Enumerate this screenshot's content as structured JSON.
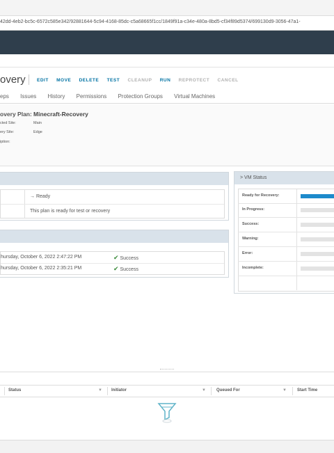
{
  "address_bar": {
    "url": "42dd-4eb2-bc5c-6572c585e342/92881644-5c94-4168-85dc-c5a68665f1cc/1849f91a-c34e-480a-8bd5-cf34f89d5374/699130d9-3056-47a1-"
  },
  "page": {
    "title": "overy",
    "actions": [
      {
        "label": "EDIT",
        "enabled": true
      },
      {
        "label": "MOVE",
        "enabled": true
      },
      {
        "label": "DELETE",
        "enabled": true
      },
      {
        "label": "TEST",
        "enabled": true
      },
      {
        "label": "CLEANUP",
        "enabled": false
      },
      {
        "label": "RUN",
        "enabled": true
      },
      {
        "label": "REPROTECT",
        "enabled": false
      },
      {
        "label": "CANCEL",
        "enabled": false
      }
    ],
    "tabs": [
      "eps",
      "Issues",
      "History",
      "Permissions",
      "Protection Groups",
      "Virtual Machines"
    ]
  },
  "summary": {
    "plan_label": "overy Plan:",
    "plan_name": "Minecraft-Recovery",
    "protected_label": "cted Site:",
    "protected_value": "Main",
    "recovery_label": "ery Site:",
    "recovery_value": "Edge",
    "description_label": "iption:"
  },
  "plan_status": {
    "status_text": "→ Ready",
    "message": "This plan is ready for test or recovery"
  },
  "history": {
    "rows": [
      {
        "date": "hursday, October 6, 2022 2:47:22 PM",
        "result": "Success"
      },
      {
        "date": "hursday, October 6, 2022 2:35:21 PM",
        "result": "Success"
      }
    ]
  },
  "vm_status": {
    "title": "> VM Status",
    "rows": [
      {
        "label": "Ready for Recovery:",
        "fill": 1.0
      },
      {
        "label": "In Progress:",
        "fill": 0
      },
      {
        "label": "Success:",
        "fill": 0
      },
      {
        "label": "Warning:",
        "fill": 0
      },
      {
        "label": "Error:",
        "fill": 0
      },
      {
        "label": "Incomplete:",
        "fill": 0
      }
    ]
  },
  "tasks": {
    "columns": [
      "Status",
      "Initiator",
      "Queued For",
      "Start Time"
    ]
  },
  "colors": {
    "header_bg": "#2f3e4c",
    "action_enabled": "#0072a3",
    "action_disabled": "#b0b0b0",
    "progress_fill": "#1d8acb",
    "success_green": "#3e8d3e"
  },
  "icons": {
    "check": "checkmark-icon",
    "filter": "funnel-icon",
    "empty_state": "empty-funnel-icon"
  }
}
